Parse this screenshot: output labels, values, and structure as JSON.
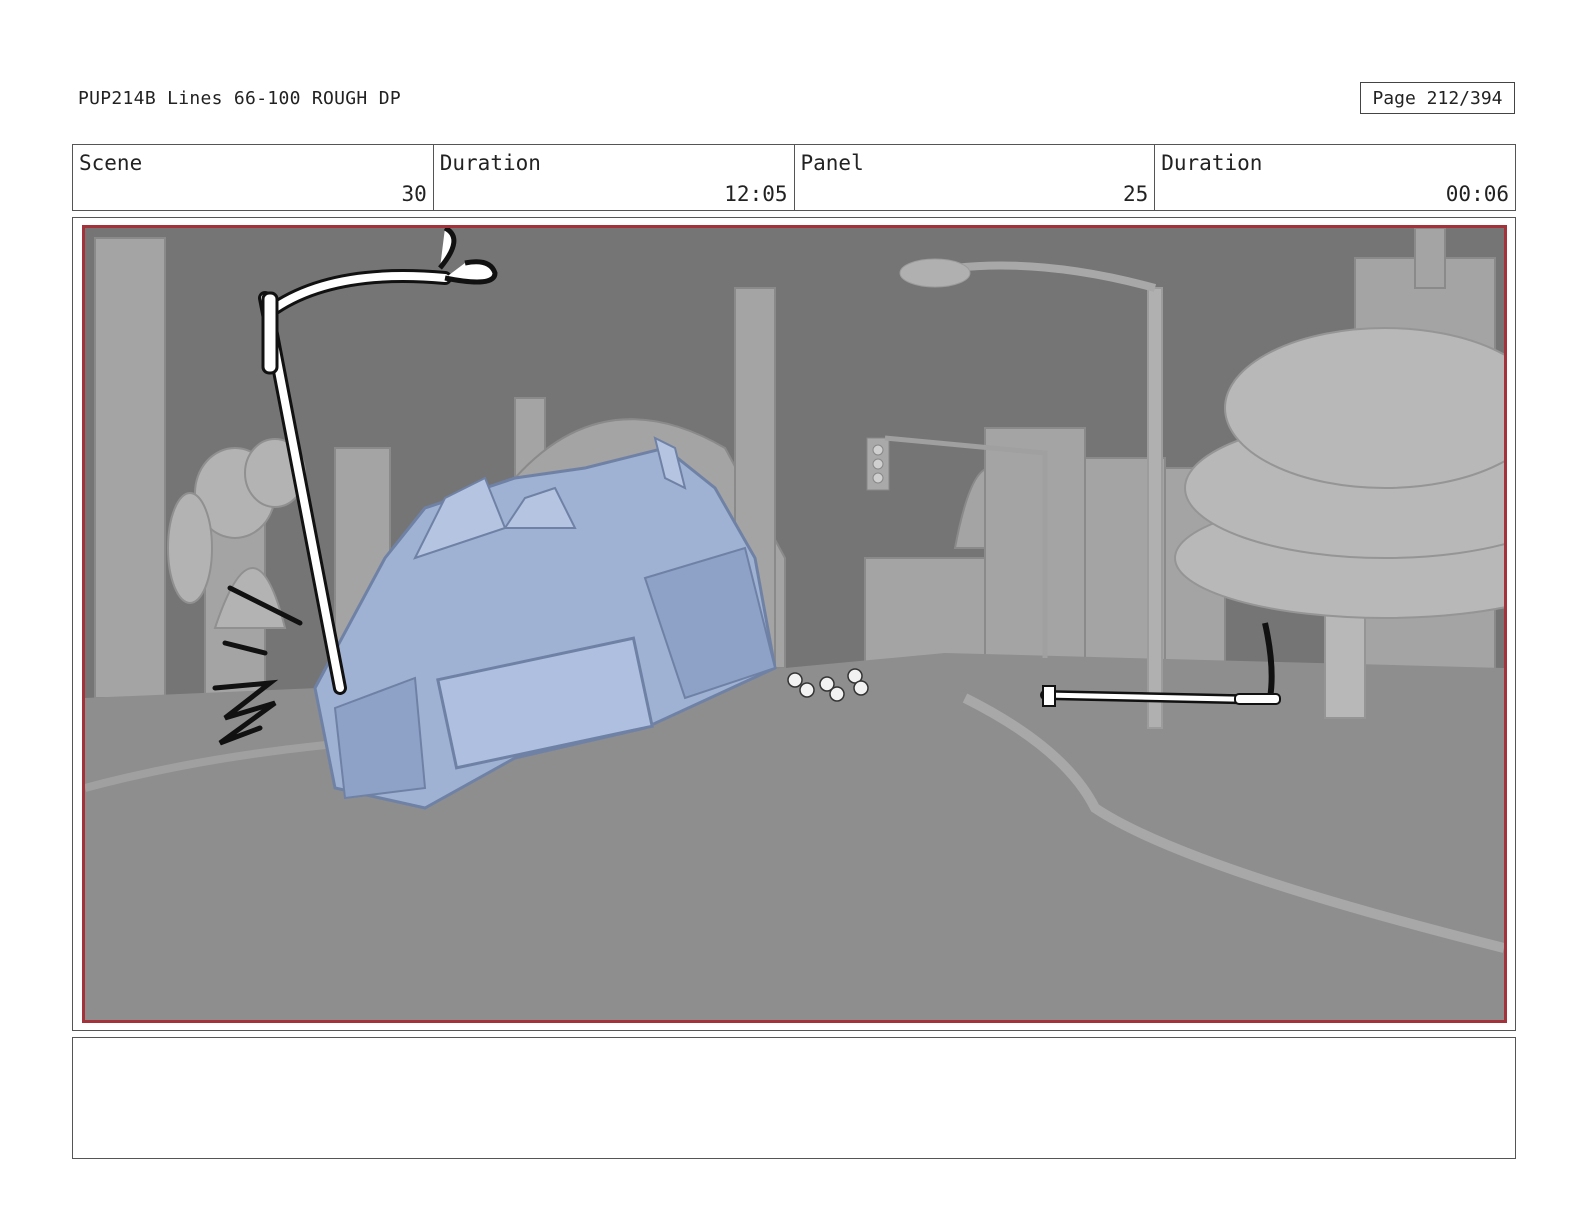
{
  "header": {
    "title": "PUP214B Lines 66-100 ROUGH DP",
    "page": "Page 212/394"
  },
  "info": {
    "scene_label": "Scene",
    "scene_value": "30",
    "scene_duration_label": "Duration",
    "scene_duration_value": "12:05",
    "panel_label": "Panel",
    "panel_value": "25",
    "panel_duration_label": "Duration",
    "panel_duration_value": "00:06"
  },
  "artwork": {
    "description_icon": "storyboard-frame-city-street-tank",
    "colors": {
      "sky": "#777777",
      "road": "#8e8e8e",
      "buildings": "#a9a9a9",
      "tank": "#9fb2d4",
      "frame_border": "#a3323a"
    }
  },
  "notes": {
    "text": ""
  }
}
